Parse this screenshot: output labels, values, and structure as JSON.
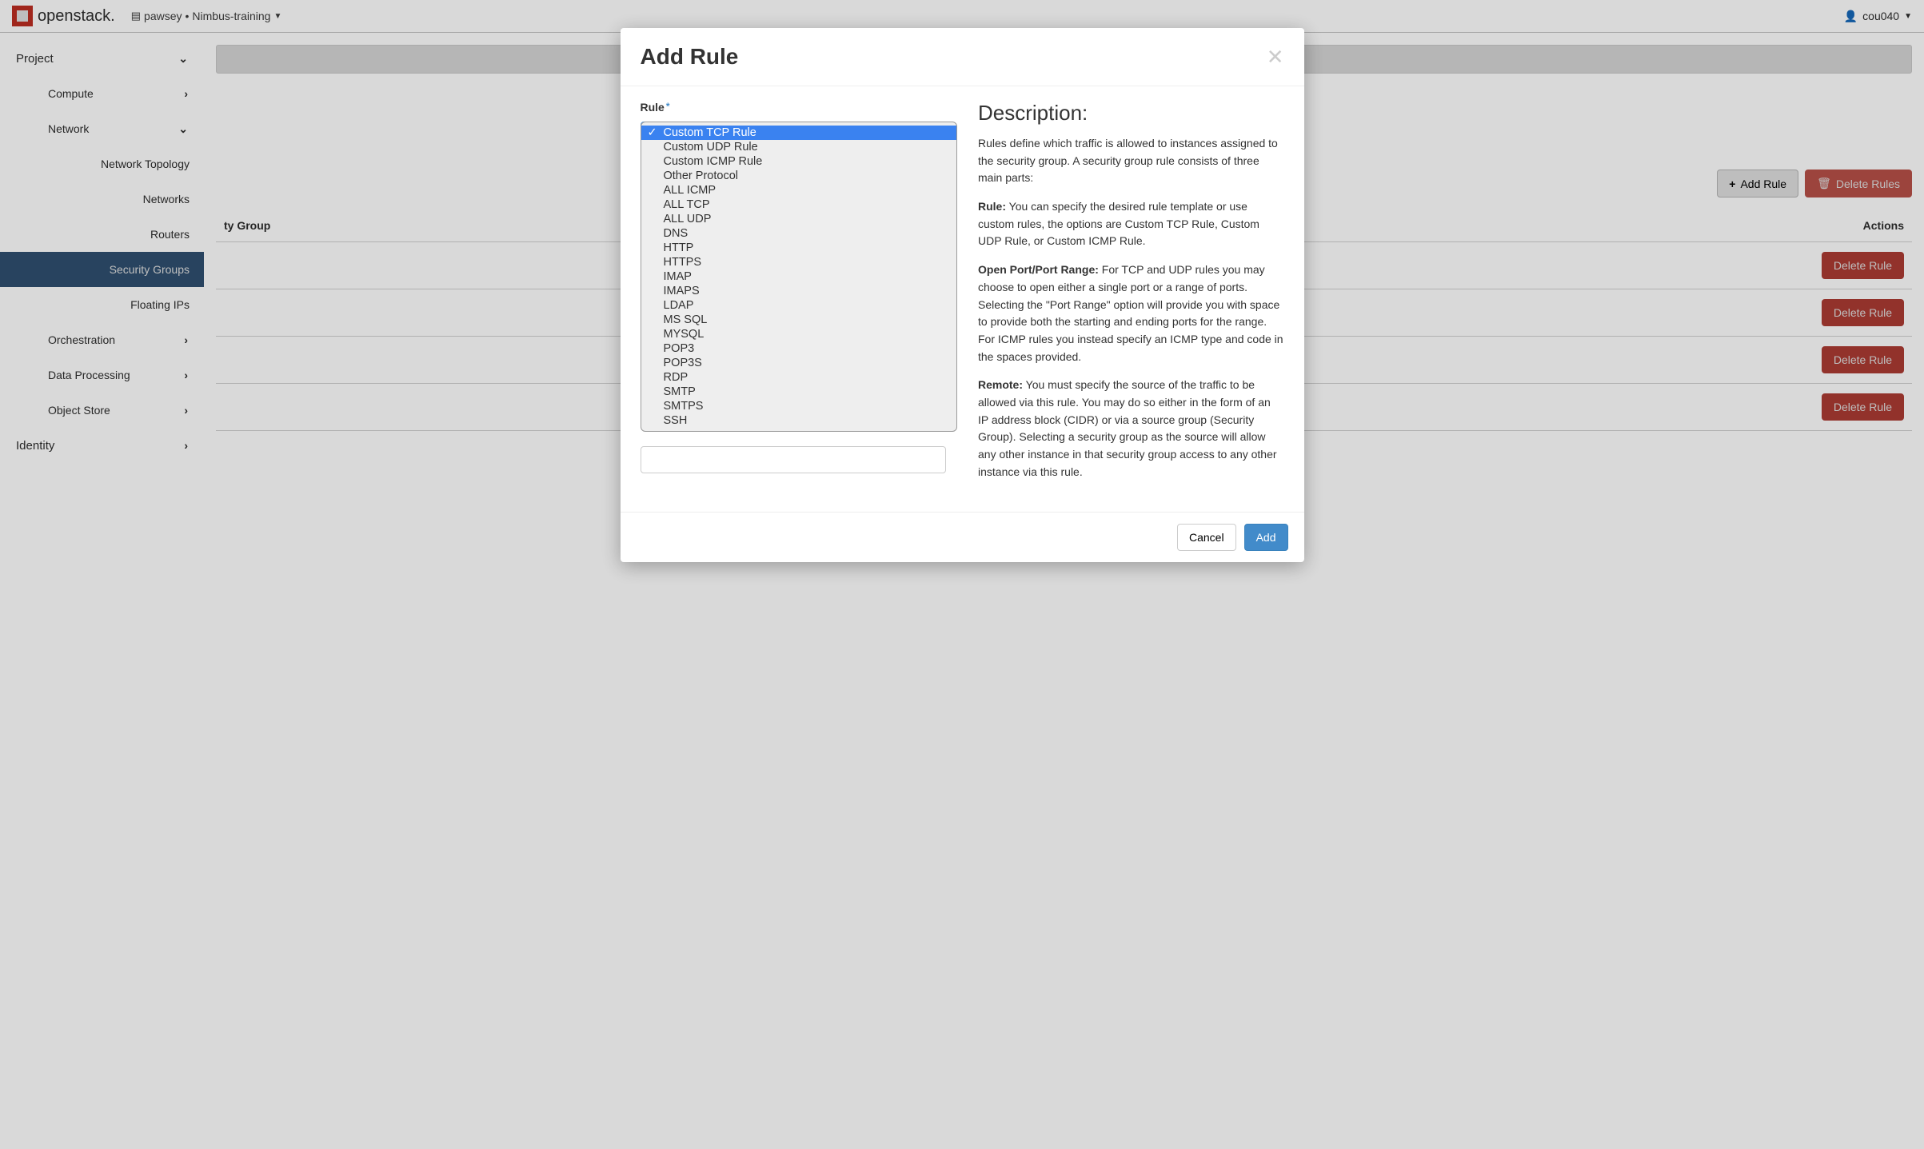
{
  "topnav": {
    "brand": "openstack.",
    "context_org": "pawsey",
    "context_bullet": "•",
    "context_project": "Nimbus-training",
    "user": "cou040"
  },
  "sidebar": {
    "project": "Project",
    "compute": "Compute",
    "network": "Network",
    "network_items": {
      "topology": "Network Topology",
      "networks": "Networks",
      "routers": "Routers",
      "security_groups": "Security Groups",
      "floating_ips": "Floating IPs"
    },
    "orchestration": "Orchestration",
    "data_processing": "Data Processing",
    "object_store": "Object Store",
    "identity": "Identity"
  },
  "toolbar": {
    "add_rule": "Add Rule",
    "delete_rules": "Delete Rules"
  },
  "table": {
    "col_group": "ty Group",
    "col_actions": "Actions",
    "row_action": "Delete Rule"
  },
  "modal": {
    "title": "Add Rule",
    "rule_label": "Rule",
    "desc_heading": "Description:",
    "p1": "Rules define which traffic is allowed to instances assigned to the security group. A security group rule consists of three main parts:",
    "p2_label": "Rule:",
    "p2_text": " You can specify the desired rule template or use custom rules, the options are Custom TCP Rule, Custom UDP Rule, or Custom ICMP Rule.",
    "p3_label": "Open Port/Port Range:",
    "p3_text": " For TCP and UDP rules you may choose to open either a single port or a range of ports. Selecting the \"Port Range\" option will provide you with space to provide both the starting and ending ports for the range. For ICMP rules you instead specify an ICMP type and code in the spaces provided.",
    "p4_label": "Remote:",
    "p4_text": " You must specify the source of the traffic to be allowed via this rule. You may do so either in the form of an IP address block (CIDR) or via a source group (Security Group). Selecting a security group as the source will allow any other instance in that security group access to any other instance via this rule.",
    "cancel": "Cancel",
    "add": "Add",
    "options": [
      "Custom TCP Rule",
      "Custom UDP Rule",
      "Custom ICMP Rule",
      "Other Protocol",
      "ALL ICMP",
      "ALL TCP",
      "ALL UDP",
      "DNS",
      "HTTP",
      "HTTPS",
      "IMAP",
      "IMAPS",
      "LDAP",
      "MS SQL",
      "MYSQL",
      "POP3",
      "POP3S",
      "RDP",
      "SMTP",
      "SMTPS",
      "SSH"
    ]
  }
}
